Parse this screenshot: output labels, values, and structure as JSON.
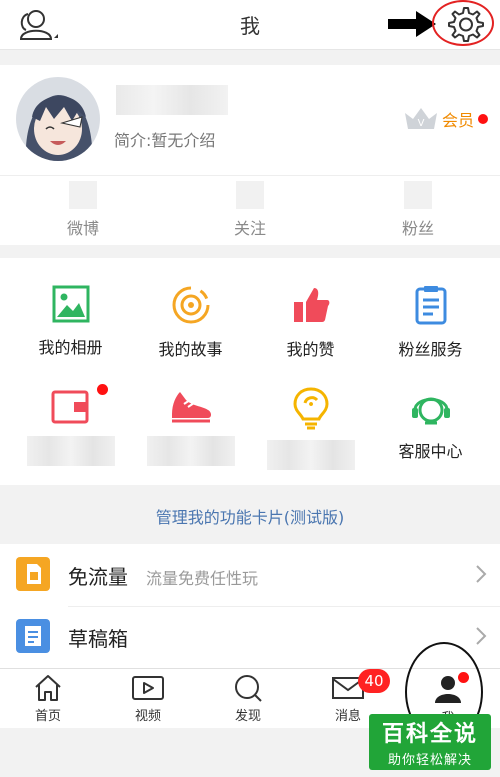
{
  "header": {
    "title": "我"
  },
  "profile": {
    "intro": "简介:暂无介绍",
    "vip_label": "会员",
    "stats": [
      {
        "label": "微博"
      },
      {
        "label": "关注"
      },
      {
        "label": "粉丝"
      }
    ]
  },
  "features": [
    {
      "label": "我的相册",
      "icon": "photo-album-icon"
    },
    {
      "label": "我的故事",
      "icon": "story-icon"
    },
    {
      "label": "我的赞",
      "icon": "thumbs-up-icon"
    },
    {
      "label": "粉丝服务",
      "icon": "fan-service-icon"
    },
    {
      "label": "",
      "icon": "wallet-icon"
    },
    {
      "label": "",
      "icon": "sneaker-icon"
    },
    {
      "label": "",
      "icon": "lightbulb-icon"
    },
    {
      "label": "客服中心",
      "icon": "customer-service-icon"
    }
  ],
  "manage_cards": "管理我的功能卡片(测试版)",
  "list": [
    {
      "title": "免流量",
      "subtitle": "流量免费任性玩",
      "icon": "sim-card-icon",
      "color": "#f5a623"
    },
    {
      "title": "草稿箱",
      "subtitle": "",
      "icon": "drafts-icon",
      "color": "#4a8fe2"
    }
  ],
  "tabs": [
    {
      "label": "首页",
      "icon": "home-icon"
    },
    {
      "label": "视频",
      "icon": "video-icon"
    },
    {
      "label": "发现",
      "icon": "discover-icon"
    },
    {
      "label": "消息",
      "icon": "message-icon",
      "badge": "40"
    },
    {
      "label": "我",
      "icon": "profile-icon"
    }
  ],
  "watermark": {
    "line1": "百科全说",
    "line2": "助你轻松解决"
  },
  "colors": {
    "accent_orange": "#f08a00",
    "badge_red": "#f22222",
    "link_blue": "#4a76b0",
    "watermark_green": "#21a538"
  }
}
